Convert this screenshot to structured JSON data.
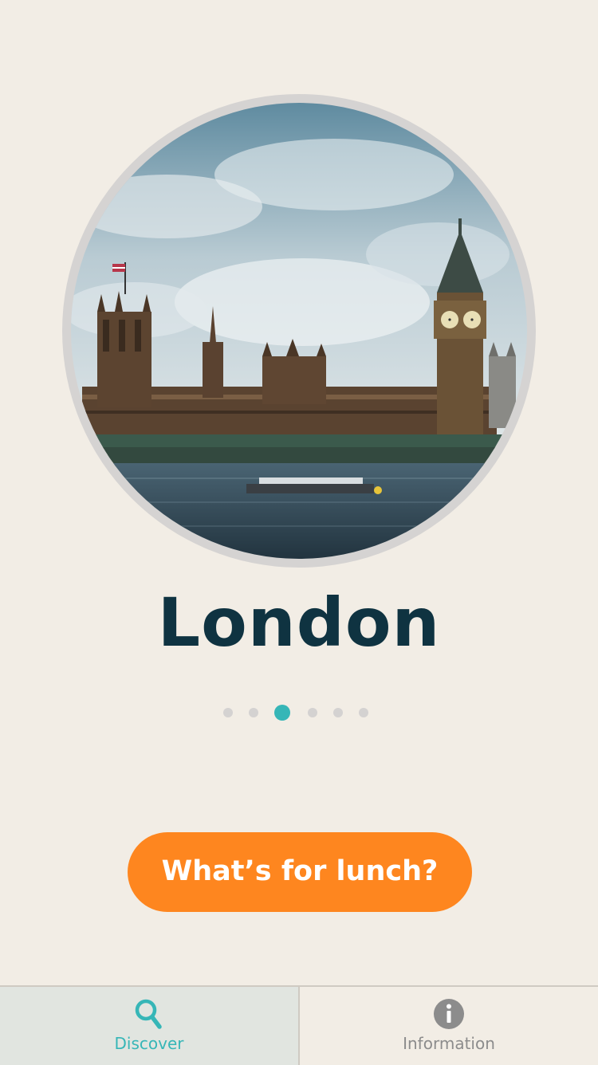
{
  "city": {
    "name": "London",
    "image_alt": "Houses of Parliament and Big Ben across the River Thames"
  },
  "pager": {
    "total": 6,
    "active_index": 2
  },
  "actions": {
    "lunch_label": "What’s for lunch?"
  },
  "tabbar": {
    "tabs": [
      {
        "label": "Discover",
        "icon": "search-icon",
        "selected": true
      },
      {
        "label": "Information",
        "icon": "info-icon",
        "selected": false
      }
    ]
  },
  "colors": {
    "background": "#f2ede5",
    "title": "#0f3341",
    "accent": "#36b6b7",
    "button": "#fe861f",
    "inactive": "#8c8c8c"
  }
}
